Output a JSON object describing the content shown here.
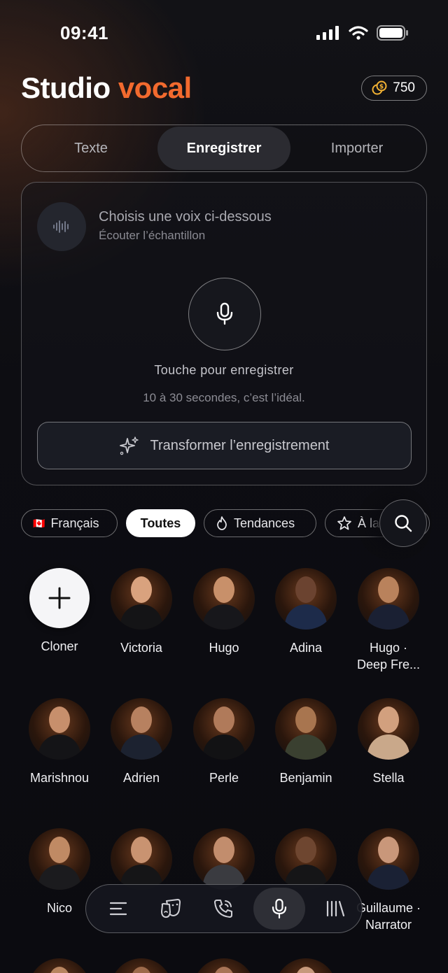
{
  "status": {
    "time": "09:41"
  },
  "header": {
    "title_main": "Studio",
    "title_accent": "vocal",
    "credits": "750",
    "accent_color": "#f26a2e"
  },
  "tabs": [
    {
      "label": "Texte",
      "active": false
    },
    {
      "label": "Enregistrer",
      "active": true
    },
    {
      "label": "Importer",
      "active": false
    }
  ],
  "recorder": {
    "voice_title": "Choisis une voix ci-dessous",
    "voice_subtitle": "Écouter l’échantillon",
    "record_label": "Touche pour enregistrer",
    "record_hint": "10 à 30 secondes, c’est l’idéal.",
    "transform_label": "Transformer l’enregistrement"
  },
  "filters": {
    "language": "Français",
    "language_flag": "🇨🇦",
    "all": "Toutes",
    "trending": "Tendances",
    "favorites": "À la"
  },
  "voices": [
    {
      "name": "Cloner",
      "type": "add"
    },
    {
      "name": "Victoria"
    },
    {
      "name": "Hugo"
    },
    {
      "name": "Adina"
    },
    {
      "name": "Hugo ·\nDeep Fre..."
    },
    {
      "name": "Marishnou"
    },
    {
      "name": "Adrien"
    },
    {
      "name": "Perle"
    },
    {
      "name": "Benjamin"
    },
    {
      "name": "Stella"
    },
    {
      "name": "Nico"
    },
    {
      "name": ""
    },
    {
      "name": ""
    },
    {
      "name": ""
    },
    {
      "name": "Guillaume ·\nNarrator"
    }
  ],
  "nav": [
    {
      "icon": "list-icon"
    },
    {
      "icon": "masks-icon"
    },
    {
      "icon": "phone-icon"
    },
    {
      "icon": "mic-icon",
      "active": true
    },
    {
      "icon": "library-icon"
    }
  ]
}
